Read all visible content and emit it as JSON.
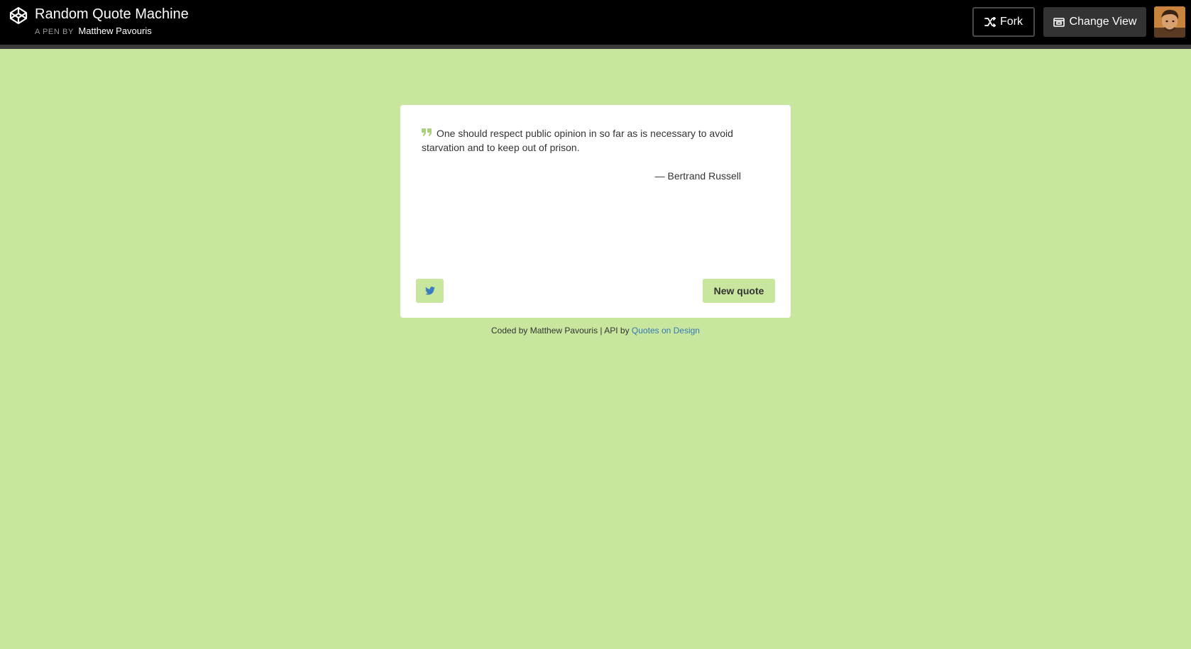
{
  "header": {
    "title": "Random Quote Machine",
    "byline_prefix": "A PEN BY",
    "author": "Matthew Pavouris",
    "logo_icon": "codepen-logo-icon",
    "fork_label": "Fork",
    "fork_icon": "fork-icon",
    "change_view_label": "Change View",
    "change_view_icon": "layout-icon",
    "avatar_icon": "user-avatar"
  },
  "quote": {
    "icon": "quote-icon",
    "text": "One should respect public opinion in so far as is necessary to avoid starvation and to keep out of prison.",
    "author": "— Bertrand Russell"
  },
  "actions": {
    "tweet_icon": "twitter-icon",
    "new_quote_label": "New quote"
  },
  "footer": {
    "coded_by": "Coded by Matthew Pavouris | API by",
    "api_link": "Quotes on Design"
  },
  "colors": {
    "background": "#c8e69e",
    "header": "#000000",
    "card": "#ffffff",
    "accent": "#c8e69e",
    "link": "#337ab7",
    "twitter": "#3b7bbf"
  }
}
